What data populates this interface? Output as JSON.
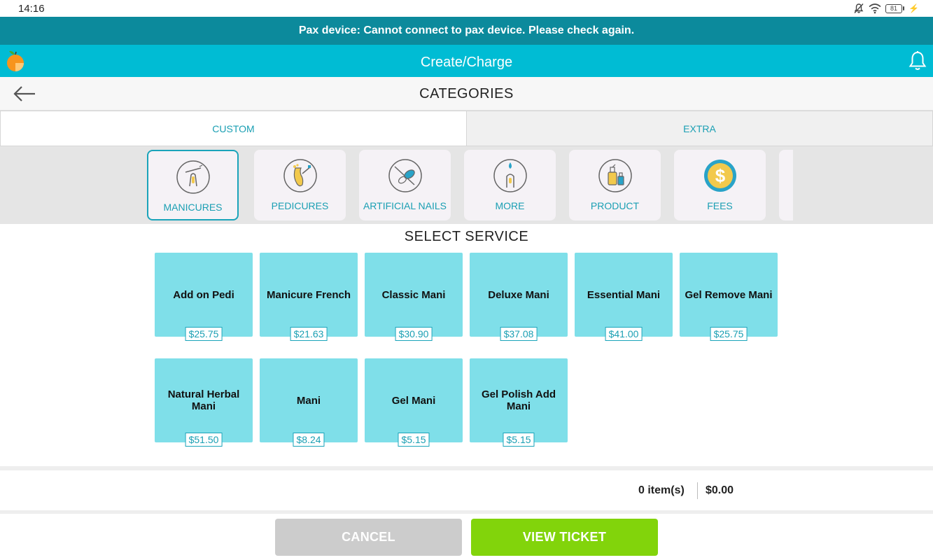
{
  "status_bar": {
    "time": "14:16",
    "battery_level": "81"
  },
  "alert": {
    "message": "Pax device: Cannot connect to pax device. Please check again."
  },
  "app_bar": {
    "title": "Create/Charge"
  },
  "sub_header": {
    "title": "CATEGORIES"
  },
  "tabs": [
    {
      "label": "CUSTOM",
      "active": true
    },
    {
      "label": "EXTRA",
      "active": false
    }
  ],
  "categories": [
    {
      "label": "MANICURES",
      "icon": "manicure-icon",
      "selected": true
    },
    {
      "label": "PEDICURES",
      "icon": "pedicure-icon",
      "selected": false
    },
    {
      "label": "ARTIFICIAL NAILS",
      "icon": "artificial-nails-icon",
      "selected": false
    },
    {
      "label": "MORE",
      "icon": "more-services-icon",
      "selected": false
    },
    {
      "label": "PRODUCT",
      "icon": "product-bottles-icon",
      "selected": false
    },
    {
      "label": "FEES",
      "icon": "dollar-coin-icon",
      "selected": false
    }
  ],
  "select_service": {
    "title": "SELECT SERVICE"
  },
  "services": [
    {
      "name": "Add on Pedi",
      "price": "$25.75"
    },
    {
      "name": "Manicure French",
      "price": "$21.63"
    },
    {
      "name": "Classic Mani",
      "price": "$30.90"
    },
    {
      "name": "Deluxe Mani",
      "price": "$37.08"
    },
    {
      "name": "Essential Mani",
      "price": "$41.00"
    },
    {
      "name": "Gel Remove Mani",
      "price": "$25.75"
    },
    {
      "name": "Natural Herbal Mani",
      "price": "$51.50"
    },
    {
      "name": "Mani",
      "price": "$8.24"
    },
    {
      "name": "Gel Mani",
      "price": "$5.15"
    },
    {
      "name": "Gel Polish Add Mani",
      "price": "$5.15"
    }
  ],
  "summary": {
    "items": "0 item(s)",
    "total": "$0.00"
  },
  "actions": {
    "cancel_label": "CANCEL",
    "view_ticket_label": "VIEW TICKET"
  },
  "colors": {
    "alert_bg": "#0c8a9c",
    "app_bar_bg": "#00bcd4",
    "accent": "#1a9fb3",
    "service_tile": "#7fdfe9",
    "view_ticket": "#82d40b",
    "cancel": "#cccccc"
  }
}
